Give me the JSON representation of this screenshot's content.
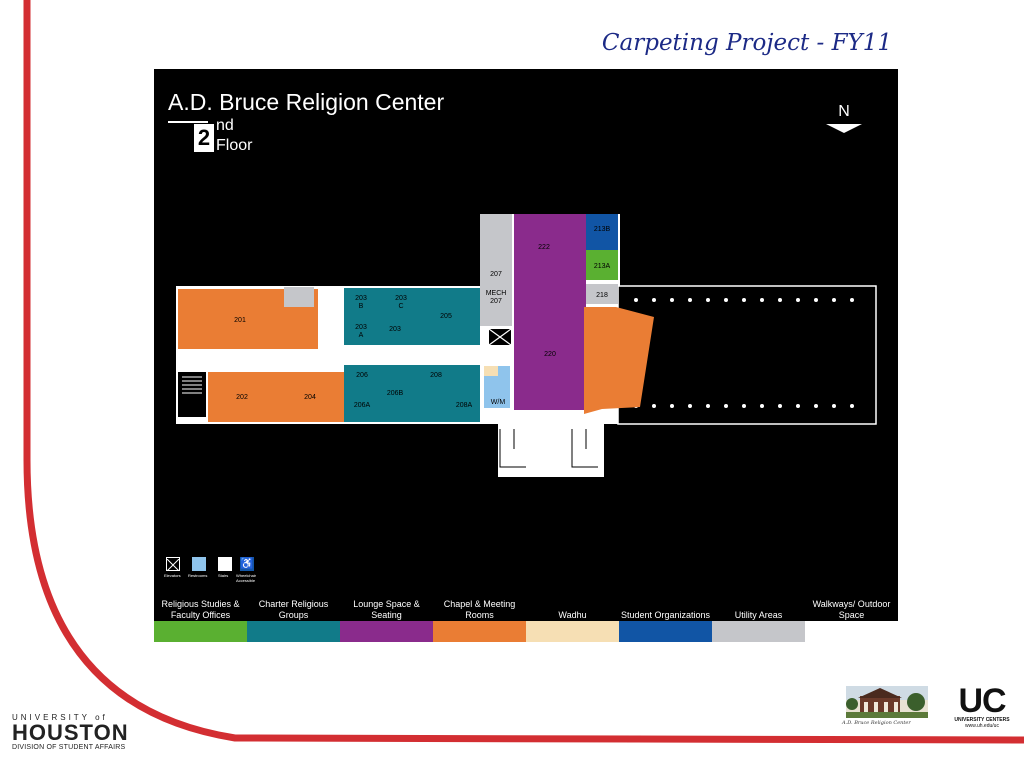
{
  "slide": {
    "title": "Carpeting Project - FY11"
  },
  "map": {
    "building_name": "A.D. Bruce Religion Center",
    "floor_number": "2",
    "floor_suffix": "nd",
    "floor_word": "Floor",
    "north_label": "N",
    "rooms": {
      "r201": "201",
      "r202": "202",
      "r203a_top": "203",
      "r203a_bot": "A",
      "r203b_top": "203",
      "r203b_bot": "B",
      "r203c_top": "203",
      "r203c_bot": "C",
      "r203": "203",
      "r204": "204",
      "r205": "205",
      "r206": "206",
      "r206a": "206A",
      "r206b": "206B",
      "r207": "207",
      "r_mech": "MECH",
      "r_mech207": "207",
      "r208": "208",
      "r208a": "208A",
      "r213a": "213A",
      "r213b": "213B",
      "r218": "218",
      "r220": "220",
      "r222": "222",
      "r_wm": "W/M"
    },
    "icon_legend": [
      {
        "icon": "elevator-icon",
        "label": "Elevators"
      },
      {
        "icon": "restroom-icon",
        "label": "Restrooms"
      },
      {
        "icon": "stairs-icon",
        "label": "Stairs"
      },
      {
        "icon": "wheelchair-icon",
        "label": "Wheelchair Accessible"
      }
    ],
    "color_legend": [
      {
        "label": "Religious Studies & Faculty Offices",
        "color": "#5ab031"
      },
      {
        "label": "Charter Religious Groups",
        "color": "#117b89"
      },
      {
        "label": "Lounge Space & Seating",
        "color": "#8a2b8c"
      },
      {
        "label": "Chapel & Meeting Rooms",
        "color": "#ea7d34"
      },
      {
        "label": "Wadhu",
        "color": "#f6dfb4"
      },
      {
        "label": "Student Organizations",
        "color": "#1155a5"
      },
      {
        "label": "Utility Areas",
        "color": "#c5c6ca"
      },
      {
        "label": "Walkways/ Outdoor Space",
        "color": "#ffffff"
      }
    ]
  },
  "footer": {
    "university_top": "UNIVERSITY of",
    "university_main": "HOUSTON",
    "division": "DIVISION OF STUDENT AFFAIRS",
    "photo_caption": "A.D. Bruce Religion Center",
    "uc_mark": "UC",
    "uc_sub": "UNIVERSITY CENTERS",
    "uc_url": "www.uh.edu/uc"
  },
  "colors": {
    "accent_red": "#d32e32",
    "title_blue": "#1c2a86"
  }
}
